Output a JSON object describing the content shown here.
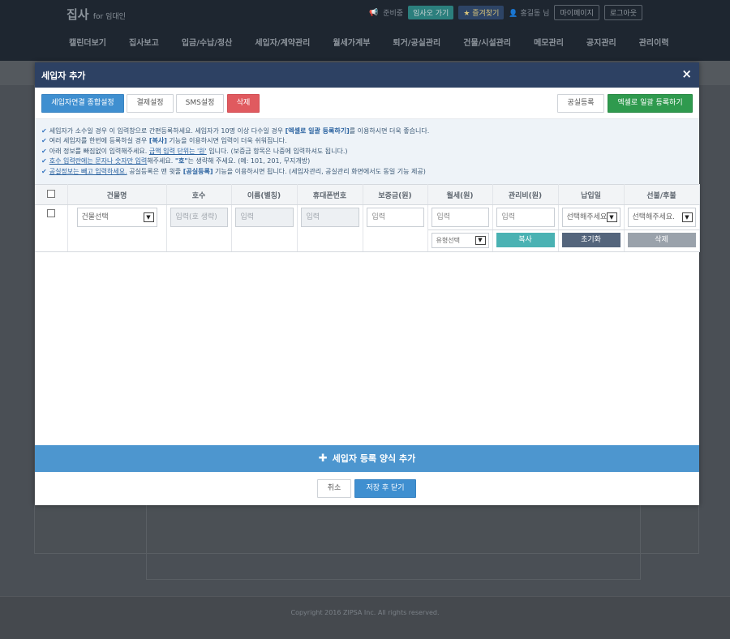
{
  "bg": {
    "logo": "집사",
    "logo_sub": "for 임대인",
    "util": {
      "badge": "준비중",
      "tenant_btn": "임사오 가기",
      "fav_btn": "즐겨찾기",
      "user": "홍길동 님",
      "mypage": "마이페이지",
      "logout": "로그아웃"
    },
    "nav": [
      "캘린더보기",
      "집사보고",
      "입금/수납/정산",
      "세입자/계약관리",
      "월세가계부",
      "퇴거/공실관리",
      "건물/시설관리",
      "메모관리",
      "공지관리",
      "관리이력"
    ],
    "copyright": "Copyright 2016 ZIPSA Inc. All rights reserved."
  },
  "modal": {
    "title": "세입자 추가",
    "close": "×",
    "toolbar": {
      "link_settings": "세입자연결 종합설정",
      "payment_settings": "결제설정",
      "sms_settings": "SMS설정",
      "delete": "삭제",
      "vacancy_register": "공실등록",
      "excel_register": "엑셀로 일괄 등록하기"
    },
    "notices": [
      [
        "세입자가 소수일 경우 이 입력창으로 간편등록하세요. 세입자가 10명 이상 다수일 경우 ",
        "[엑셀로 일괄 등록하기]",
        "를 이용하시면 더욱 좋습니다."
      ],
      [
        "여러 세입자를 한번에 등록하실 경우 ",
        "[복사]",
        " 기능을 이용하시면 입력이 더욱 쉬워집니다."
      ],
      [
        "아래 정보를 빠짐없이 입력해주세요. ",
        "금액 입력 단위는 '원'",
        " 입니다. (보증금 항목은 나중에 입력하셔도 됩니다.)"
      ],
      [
        "호수 입력란에는 문자나 숫자만 입력",
        "해주세요. ",
        "\"호\"",
        "는 생략해 주세요. (예: 101, 201, 무지개방)"
      ],
      [
        "공실정보는 빼고 입력하세요.",
        " 공실등록은 맨 윗줄 ",
        "[공실등록]",
        " 기능을 이용하시면 됩니다. (세입자관리, 공실관리 화면에서도 동일 기능 제공)"
      ]
    ],
    "columns": [
      "건물명",
      "호수",
      "이름(별칭)",
      "휴대폰번호",
      "보증금(원)",
      "월세(원)",
      "관리비(원)",
      "납입일",
      "선불/후불"
    ],
    "row": {
      "building_select": "건물선택",
      "unit_placeholder": "입력(호 생략)",
      "name_placeholder": "입력",
      "phone_placeholder": "입력",
      "deposit_placeholder": "입력",
      "rent_placeholder": "입력",
      "fee_placeholder": "입력",
      "payday_select": "선택해주세요.",
      "prepay_select": "선택해주세요.",
      "type_select": "유형선택",
      "copy": "복사",
      "reset": "초기화",
      "delete": "삭제"
    },
    "add_form": "세입자 등록 양식 추가",
    "cancel": "취소",
    "save_close": "저장 후 닫기"
  }
}
